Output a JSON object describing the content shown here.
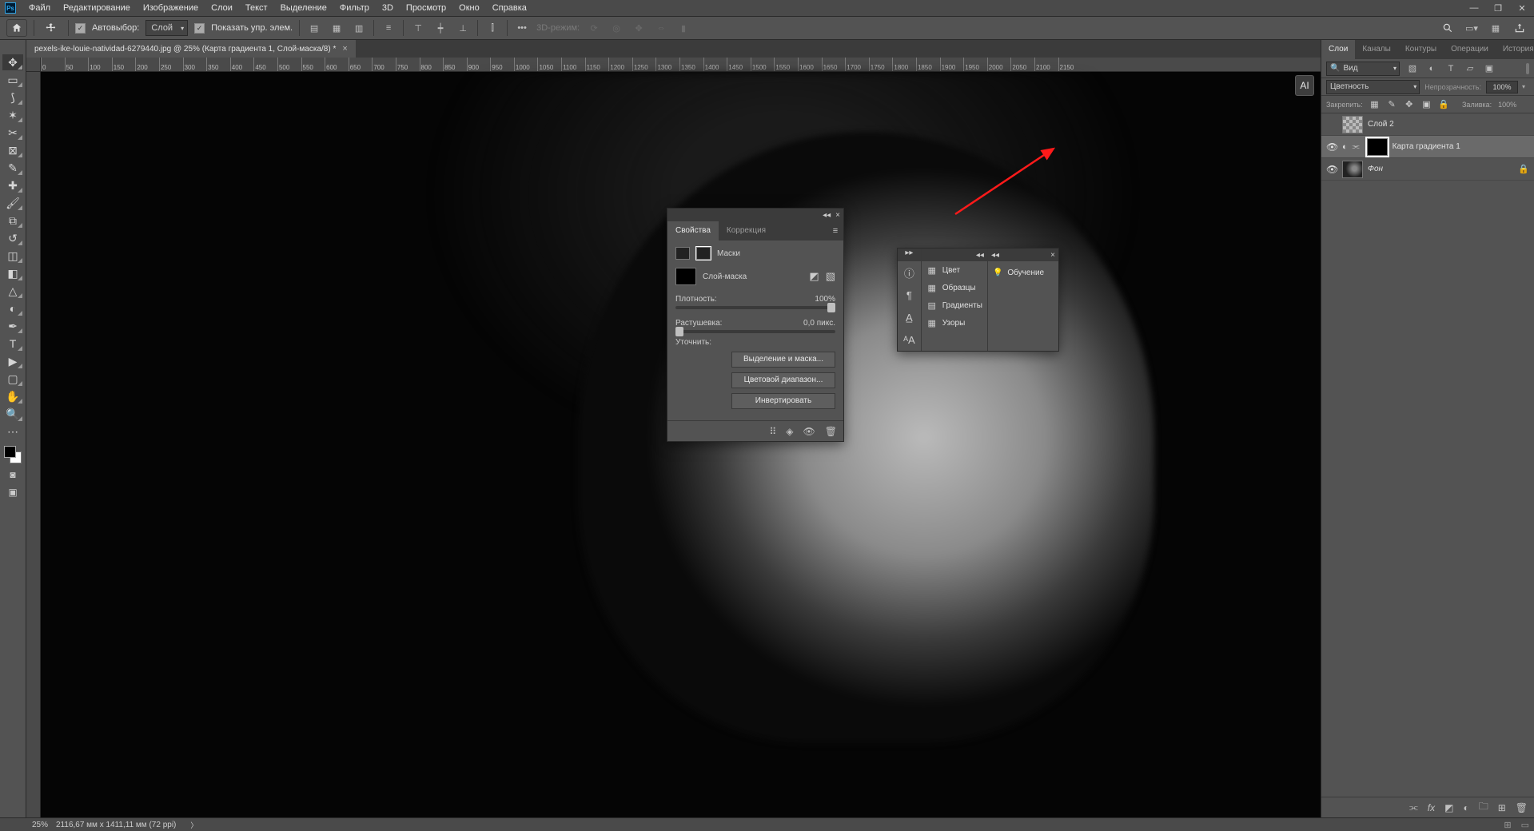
{
  "menu": {
    "items": [
      "Файл",
      "Редактирование",
      "Изображение",
      "Слои",
      "Текст",
      "Выделение",
      "Фильтр",
      "3D",
      "Просмотр",
      "Окно",
      "Справка"
    ]
  },
  "options": {
    "autoSelectLabel": "Автовыбор:",
    "autoSelectTarget": "Слой",
    "showTransformLabel": "Показать упр. элем.",
    "threeDMode": "3D-режим:"
  },
  "document": {
    "tabTitle": "pexels-ike-louie-natividad-6279440.jpg @ 25% (Карта градиента 1, Слой-маска/8) *"
  },
  "ruler": {
    "ticks": [
      "0",
      "50",
      "100",
      "150",
      "200",
      "250",
      "300",
      "350",
      "400",
      "450",
      "500",
      "550",
      "600",
      "650",
      "700",
      "750",
      "800",
      "850",
      "900",
      "950",
      "1000",
      "1050",
      "1100",
      "1150",
      "1200",
      "1250",
      "1300",
      "1350",
      "1400",
      "1450",
      "1500",
      "1550",
      "1600",
      "1650",
      "1700",
      "1750",
      "1800",
      "1850",
      "1900",
      "1950",
      "2000",
      "2050",
      "2100",
      "2150"
    ]
  },
  "status": {
    "zoom": "25%",
    "docInfo": "2116,67 мм x 1411,11 мм (72 ppi)"
  },
  "layersPanel": {
    "tabs": [
      "Слои",
      "Каналы",
      "Контуры",
      "Операции",
      "История"
    ],
    "filterKind": "Вид",
    "blendMode": "Цветность",
    "opacityLabel": "Непрозрачность:",
    "opacityValue": "100%",
    "lockLabel": "Закрепить:",
    "fillLabel": "Заливка:",
    "fillValue": "100%",
    "layers": [
      {
        "name": "Слой 2",
        "visible": false,
        "thumb": "chk",
        "locked": false,
        "italic": false
      },
      {
        "name": "Карта градиента 1",
        "visible": true,
        "thumb": "grad",
        "hasMask": true,
        "locked": false,
        "italic": false,
        "selected": true
      },
      {
        "name": "Фон",
        "visible": true,
        "thumb": "photo",
        "locked": true,
        "italic": true
      }
    ]
  },
  "propertiesPanel": {
    "tabs": [
      "Свойства",
      "Коррекция"
    ],
    "kindLabel": "Маски",
    "maskTypeLabel": "Слой-маска",
    "density": {
      "label": "Плотность:",
      "value": "100%"
    },
    "feather": {
      "label": "Растушевка:",
      "value": "0,0 пикс."
    },
    "refineLabel": "Уточнить:",
    "buttons": [
      "Выделение и маска...",
      "Цветовой диапазон...",
      "Инвертировать"
    ]
  },
  "miniPanels": {
    "colorGroup": [
      "Цвет",
      "Образцы",
      "Градиенты",
      "Узоры"
    ],
    "learn": "Обучение"
  },
  "aiChip": "AI"
}
